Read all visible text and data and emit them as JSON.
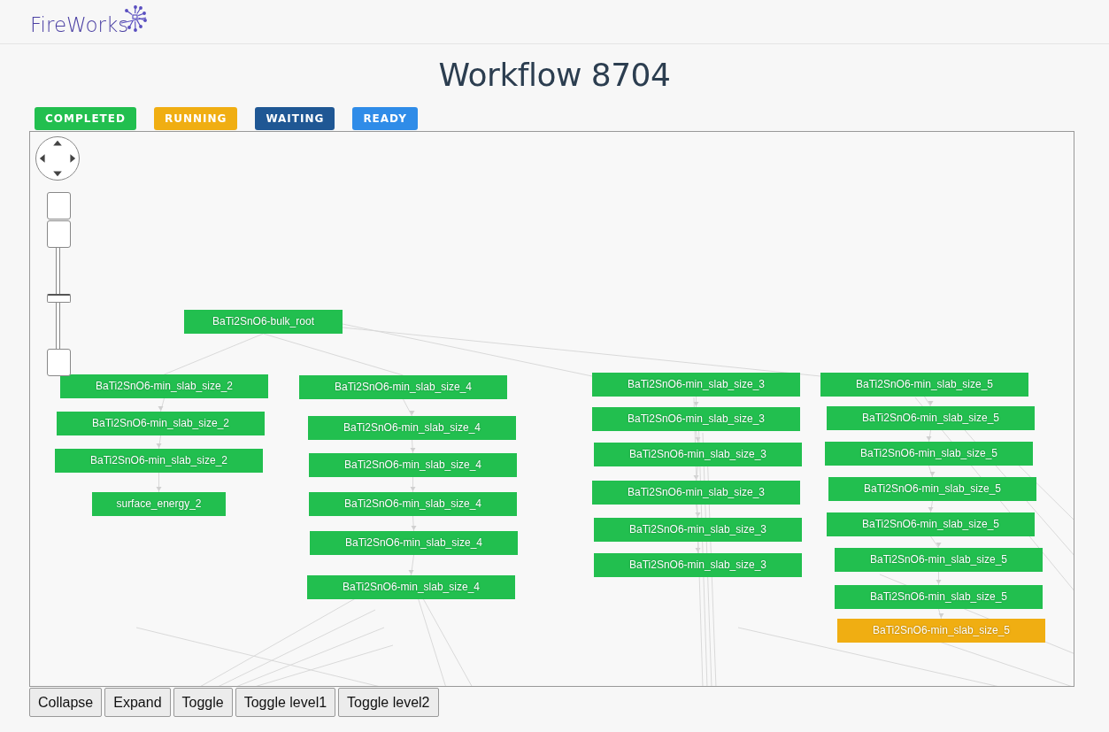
{
  "logo": {
    "text": "FireWorks"
  },
  "title": "Workflow 8704",
  "legend": [
    {
      "label": "COMPLETED",
      "color": "#22bf4f"
    },
    {
      "label": "RUNNING",
      "color": "#f0ae12"
    },
    {
      "label": "WAITING",
      "color": "#1f5794"
    },
    {
      "label": "READY",
      "color": "#2f8ce8"
    }
  ],
  "graph": {
    "zoom": {
      "level": 0.5
    },
    "root": {
      "name": "BaTi2SnO6-bulk_root",
      "color": "#22bf4f"
    },
    "branches": [
      {
        "nodes": [
          {
            "name": "BaTi2SnO6-min_slab_size_2",
            "color": "#22bf4f"
          },
          {
            "name": "BaTi2SnO6-min_slab_size_2",
            "color": "#22bf4f"
          },
          {
            "name": "BaTi2SnO6-min_slab_size_2",
            "color": "#22bf4f"
          },
          {
            "name": "surface_energy_2",
            "color": "#22bf4f"
          }
        ]
      },
      {
        "nodes": [
          {
            "name": "BaTi2SnO6-min_slab_size_4",
            "color": "#22bf4f"
          },
          {
            "name": "BaTi2SnO6-min_slab_size_4",
            "color": "#22bf4f"
          },
          {
            "name": "BaTi2SnO6-min_slab_size_4",
            "color": "#22bf4f"
          },
          {
            "name": "BaTi2SnO6-min_slab_size_4",
            "color": "#22bf4f"
          },
          {
            "name": "BaTi2SnO6-min_slab_size_4",
            "color": "#22bf4f"
          },
          {
            "name": "BaTi2SnO6-min_slab_size_4",
            "color": "#22bf4f"
          }
        ]
      },
      {
        "nodes": [
          {
            "name": "BaTi2SnO6-min_slab_size_3",
            "color": "#22bf4f"
          },
          {
            "name": "BaTi2SnO6-min_slab_size_3",
            "color": "#22bf4f"
          },
          {
            "name": "BaTi2SnO6-min_slab_size_3",
            "color": "#22bf4f"
          },
          {
            "name": "BaTi2SnO6-min_slab_size_3",
            "color": "#22bf4f"
          },
          {
            "name": "BaTi2SnO6-min_slab_size_3",
            "color": "#22bf4f"
          },
          {
            "name": "BaTi2SnO6-min_slab_size_3",
            "color": "#22bf4f"
          }
        ]
      },
      {
        "nodes": [
          {
            "name": "BaTi2SnO6-min_slab_size_5",
            "color": "#22bf4f"
          },
          {
            "name": "BaTi2SnO6-min_slab_size_5",
            "color": "#22bf4f"
          },
          {
            "name": "BaTi2SnO6-min_slab_size_5",
            "color": "#22bf4f"
          },
          {
            "name": "BaTi2SnO6-min_slab_size_5",
            "color": "#22bf4f"
          },
          {
            "name": "BaTi2SnO6-min_slab_size_5",
            "color": "#22bf4f"
          },
          {
            "name": "BaTi2SnO6-min_slab_size_5",
            "color": "#22bf4f"
          },
          {
            "name": "BaTi2SnO6-min_slab_size_5",
            "color": "#22bf4f"
          },
          {
            "name": "BaTi2SnO6-min_slab_size_5",
            "color": "#f0ae12"
          }
        ]
      }
    ]
  },
  "buttons": [
    "Collapse",
    "Expand",
    "Toggle",
    "Toggle level1",
    "Toggle level2"
  ]
}
